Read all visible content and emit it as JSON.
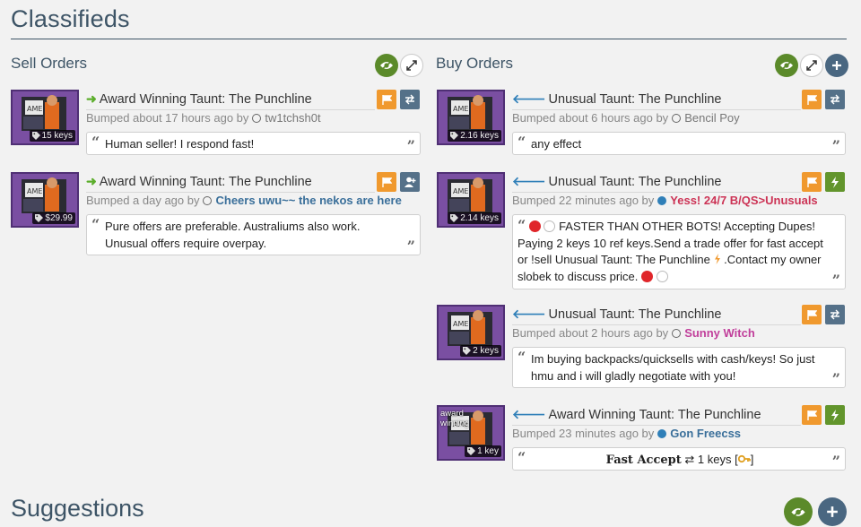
{
  "page": {
    "title": "Classifieds",
    "suggestions_title": "Suggestions"
  },
  "sell": {
    "title": "Sell Orders",
    "listings": [
      {
        "item_name": "Award Winning Taunt: The Punchline",
        "price": "15 keys",
        "bump_prefix": "Bumped about 17 hours ago by",
        "user": "tw1tchsh0t",
        "user_status": "offline",
        "icons": [
          "flag-icon",
          "trade-icon"
        ],
        "comment": "Human seller! I respond fast!"
      },
      {
        "item_name": "Award Winning Taunt: The Punchline",
        "price": "$29.99",
        "bump_prefix": "Bumped a day ago by",
        "user": "Cheers uwu~~ the nekos are here",
        "user_status": "offline",
        "icons": [
          "flag-icon",
          "add-friend-icon"
        ],
        "comment": "Pure offers are preferable. Australiums also work. Unusual offers require overpay."
      }
    ]
  },
  "buy": {
    "title": "Buy Orders",
    "listings": [
      {
        "item_name": "Unusual Taunt: The Punchline",
        "price": "2.16 keys",
        "bump_prefix": "Bumped about 6 hours ago by",
        "user": "Bencil Poy",
        "user_status": "offline",
        "icons": [
          "flag-icon",
          "trade-icon"
        ],
        "comment": "any effect"
      },
      {
        "item_name": "Unusual Taunt: The Punchline",
        "price": "2.14 keys",
        "bump_prefix": "Bumped 22 minutes ago by",
        "user": "Yess! 24/7 B/QS>Unusuals",
        "user_status": "online",
        "icons": [
          "flag-icon",
          "lightning-icon"
        ],
        "comment_a": "FASTER THAN OTHER BOTS! Accepting Dupes! Paying 2 keys 10 ref keys.Send a trade offer for fast accept or !sell Unusual Taunt: The Punchline",
        "comment_b": ".Contact my owner slobek to discuss price."
      },
      {
        "item_name": "Unusual Taunt: The Punchline",
        "price": "2 keys",
        "bump_prefix": "Bumped about 2 hours ago by",
        "user": "Sunny Witch",
        "user_status": "offline",
        "icons": [
          "flag-icon",
          "trade-icon"
        ],
        "comment": "Im buying backpacks/quicksells with cash/keys! So just hmu and i will gladly negotiate with you!"
      },
      {
        "item_name": "Award Winning Taunt: The Punchline",
        "price": "1 key",
        "thumb_overlay": "award winning",
        "bump_prefix": "Bumped 23 minutes ago by",
        "user": "Gon Freecss",
        "user_status": "online",
        "icons": [
          "flag-icon",
          "lightning-icon"
        ],
        "comment_bold": "Fast Accept",
        "comment_rest": "1 keys ["
      }
    ]
  },
  "colors": {
    "title": "#3d5466",
    "thumb_bg": "#7a4fa2",
    "flag_button": "#f0992e",
    "trade_button": "#557189",
    "lightning_button": "#62952c",
    "sell_arrow": "#5cae2c",
    "buy_arrow": "#2f7fb8"
  }
}
